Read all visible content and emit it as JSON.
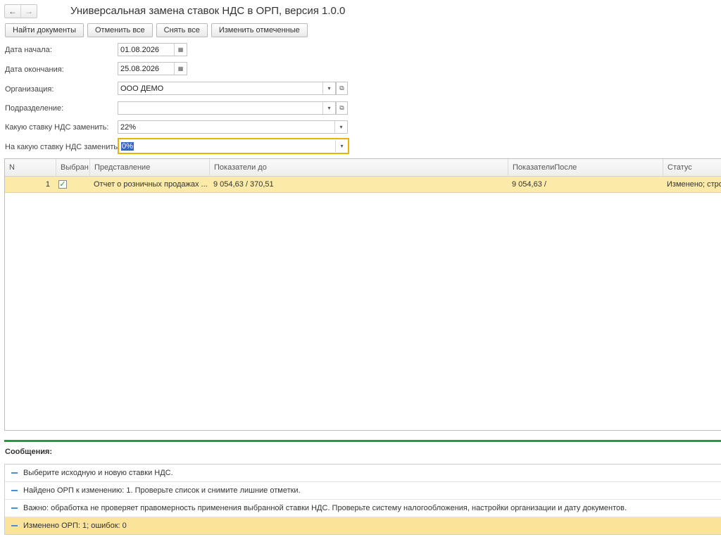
{
  "nav": {
    "back_icon": "arrow-left-icon",
    "forward_icon": "arrow-right-icon",
    "back": "←",
    "forward": "→"
  },
  "title": "Универсальная замена ставок НДС в ОРП, версия 1.0.0",
  "toolbar": {
    "find": "Найти документы",
    "cancel_all": "Отменить все",
    "uncheck_all": "Снять все",
    "change_checked": "Изменить отмеченные"
  },
  "form": {
    "date_start_label": "Дата начала:",
    "date_start": "01.08.2026",
    "date_end_label": "Дата окончания:",
    "date_end": "25.08.2026",
    "org_label": "Организация:",
    "org": "ООО ДЕМО",
    "dept_label": "Подразделение:",
    "dept": "",
    "from_rate_label": "Какую ставку НДС заменить:",
    "from_rate": "22%",
    "to_rate_label": "На какую ставку НДС заменить:",
    "to_rate": "0%"
  },
  "icons": {
    "calendar": "▦",
    "dropdown": "▾",
    "open": "⧉",
    "check": "✓"
  },
  "table": {
    "columns": [
      "N",
      "Выбран",
      "Представление",
      "Показатели до",
      "ПоказателиПосле",
      "Статус"
    ],
    "rows": [
      {
        "n": "1",
        "selected": true,
        "view": "Отчет о розничных продажах ...",
        "before": "9 054,63 / 370,51",
        "after": "9 054,63 /",
        "status": "Изменено; строк"
      }
    ]
  },
  "messages": {
    "title": "Сообщения:",
    "items": [
      {
        "text": "Выберите исходную и новую ставки НДС.",
        "highlighted": false
      },
      {
        "text": "Найдено ОРП к изменению: 1. Проверьте список и снимите лишние отметки.",
        "highlighted": false
      },
      {
        "text": "Важно: обработка не проверяет правомерность применения выбранной ставки НДС. Проверьте систему налогообложения, настройки организации и дату документов.",
        "highlighted": false
      },
      {
        "text": "Изменено ОРП: 1; ошибок: 0",
        "highlighted": true
      }
    ]
  },
  "colors": {
    "accent": "#1e9c4a",
    "row_highlight": "#fbeaa8",
    "message_highlight": "#fbe39a",
    "focus_border": "#e8b400",
    "selection": "#3366cc"
  }
}
